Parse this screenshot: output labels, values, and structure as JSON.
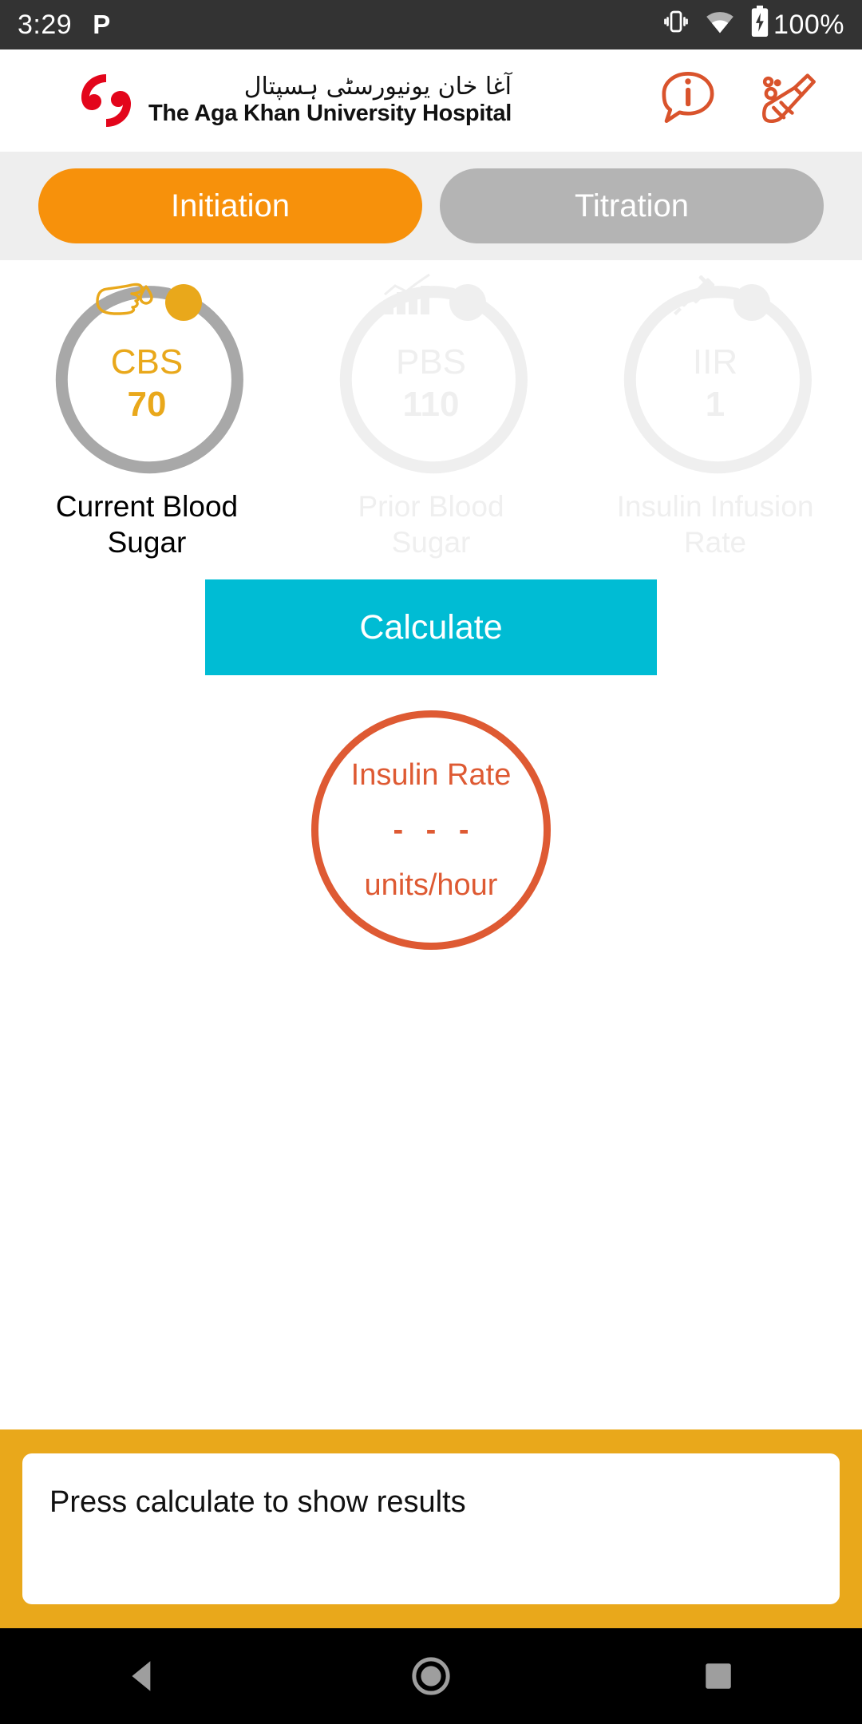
{
  "status_bar": {
    "time": "3:29",
    "app_badge": "P",
    "battery_percent": "100%",
    "icons": [
      "vibrate-icon",
      "wifi-icon",
      "battery-charging-icon"
    ],
    "background": "#333333"
  },
  "header": {
    "logo_urdu": "آغا خان یونیورسٹی ہسپتال",
    "logo_english": "The Aga Khan University Hospital",
    "logo_color": "#E3051B",
    "icon_color": "#D9532C",
    "icons": [
      {
        "name": "info-bubble-icon",
        "label": "i"
      },
      {
        "name": "broom-clear-icon",
        "label": ""
      }
    ]
  },
  "tabs": {
    "active_index": 0,
    "items": [
      {
        "label": "Initiation",
        "active": true,
        "color": "#F7910B"
      },
      {
        "label": "Titration",
        "active": false,
        "color": "#B4B4B4"
      }
    ]
  },
  "gauges": [
    {
      "abbr": "CBS",
      "value": "70",
      "label": "Current Blood Sugar",
      "icon": "blood-drop-finger-icon",
      "enabled": true,
      "ring_color": "#A8A8A8",
      "accent_color": "#E9A81B"
    },
    {
      "abbr": "PBS",
      "value": "110",
      "label": "Prior Blood Sugar",
      "icon": "bar-chart-icon",
      "enabled": false,
      "ring_color": "#EFEFEF",
      "accent_color": "#EFEFEF"
    },
    {
      "abbr": "IIR",
      "value": "1",
      "label": "Insulin Infusion Rate",
      "icon": "syringe-icon",
      "enabled": false,
      "ring_color": "#EFEFEF",
      "accent_color": "#EFEFEF"
    }
  ],
  "calculate": {
    "label": "Calculate",
    "color": "#00BCD4"
  },
  "result": {
    "title": "Insulin Rate",
    "value": "- - -",
    "units": "units/hour",
    "color": "#DE5A33"
  },
  "notice": {
    "message": "Press calculate to show results",
    "panel_color": "#E9A81B"
  },
  "nav_bar": {
    "buttons": [
      {
        "name": "back-triangle-icon"
      },
      {
        "name": "home-circle-icon"
      },
      {
        "name": "recents-square-icon"
      }
    ]
  }
}
